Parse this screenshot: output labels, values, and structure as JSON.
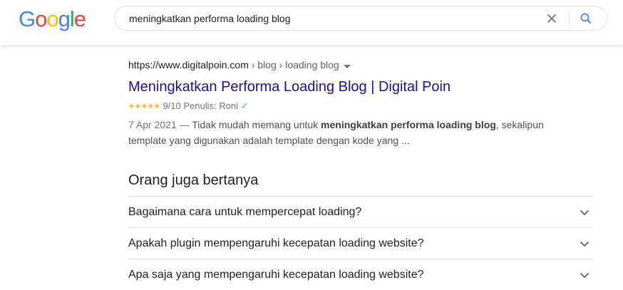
{
  "header": {
    "logo": [
      "G",
      "o",
      "o",
      "g",
      "l",
      "e"
    ],
    "logo_colors": [
      "#4285f4",
      "#ea4335",
      "#fbbc05",
      "#4285f4",
      "#34a853",
      "#ea4335"
    ],
    "search_value": "meningkatkan performa loading blog",
    "clear_icon": "close-icon",
    "search_icon": "search-icon"
  },
  "result": {
    "url_domain": "https://www.digitalpoin.com",
    "url_path": " › blog › loading blog",
    "title": "Meningkatkan Performa Loading Blog | Digital Poin",
    "stars": "★★★★★",
    "rating_text": " 9/10 Penulis: Roni ",
    "check": "✓",
    "date": "7 Apr 2021 — ",
    "snippet_before": "Tidak mudah memang untuk ",
    "snippet_bold": "meningkatkan performa loading blog",
    "snippet_after": ", sekalipun template yang digunakan adalah template dengan kode yang ..."
  },
  "paa": {
    "heading": "Orang juga bertanya",
    "questions": [
      "Bagaimana cara untuk mempercepat loading?",
      "Apakah plugin mempengaruhi kecepatan loading website?",
      "Apa saja yang mempengaruhi kecepatan loading website?"
    ]
  },
  "colors": {
    "link": "#1a0dab",
    "accent_blue": "#4285f4",
    "star": "#fbbc04"
  }
}
